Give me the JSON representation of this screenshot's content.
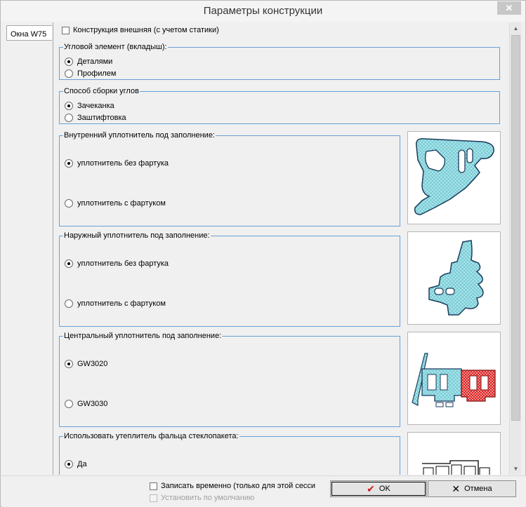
{
  "window": {
    "title": "Параметры конструкции",
    "close_glyph": "✕"
  },
  "tabs": [
    {
      "label": "Окна W75"
    }
  ],
  "top_checkbox": {
    "label": "Конструкция внешняя (с учетом статики)",
    "checked": false
  },
  "groups": {
    "corner_element": {
      "legend": "Угловой элемент (вкладыш):",
      "options": [
        "Деталями",
        "Профилем"
      ],
      "selected": 0
    },
    "corner_assembly": {
      "legend": "Способ сборки углов",
      "options": [
        "Зачеканка",
        "Заштифтовка"
      ],
      "selected": 0
    },
    "inner_seal": {
      "legend": "Внутренний уплотнитель под заполнение:",
      "options": [
        "уплотнитель без фартука",
        "уплотнитель с фартуком"
      ],
      "selected": 0
    },
    "outer_seal": {
      "legend": "Наружный уплотнитель под заполнение:",
      "options": [
        "уплотнитель без фартука",
        "уплотнитель с фартуком"
      ],
      "selected": 0
    },
    "central_seal": {
      "legend": "Центральный уплотнитель под заполнение:",
      "options": [
        "GW3020",
        "GW3030"
      ],
      "selected": 0
    },
    "glazing_insulator": {
      "legend": "Использовать утеплитель фальца стеклопакета:",
      "options": [
        "Да"
      ],
      "selected": 0
    }
  },
  "footer": {
    "save_temp_label": "Записать временно (только для этой сесси",
    "set_default_label": "Установить по умолчанию",
    "ok_label": "OK",
    "cancel_label": "Отмена"
  },
  "icons": {
    "close": "close-icon",
    "ok": "checkmark-icon",
    "cancel": "x-icon",
    "scroll_up": "arrow-up-icon",
    "scroll_down": "arrow-down-icon"
  },
  "colors": {
    "accent_border": "#6a9fd4",
    "seal_fill": "#a8e4ea",
    "seal_red": "#e02020",
    "close_bg": "#c7c7c7"
  }
}
